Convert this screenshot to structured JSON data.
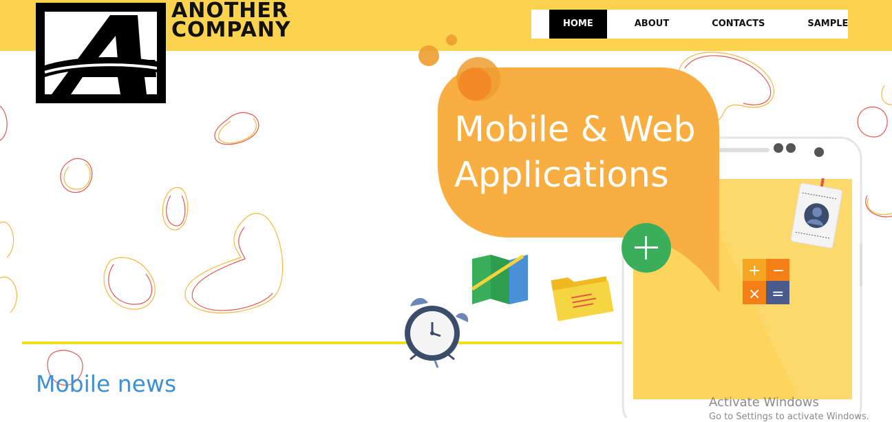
{
  "header": {
    "company_name_line1": "ANOTHER",
    "company_name_line2": "COMPANY",
    "logo_letter": "A"
  },
  "nav": {
    "items": [
      {
        "label": "HOME",
        "active": true
      },
      {
        "label": "ABOUT",
        "active": false
      },
      {
        "label": "CONTACTS",
        "active": false
      },
      {
        "label": "SAMPLE",
        "active": false
      }
    ]
  },
  "hero": {
    "title_line1": "Mobile & Web",
    "title_line2": "Applications"
  },
  "main": {
    "section_title": "Mobile news"
  },
  "overlay": {
    "watermark_title": "Activate Windows",
    "watermark_subtitle": "Go to Settings to activate Windows."
  },
  "colors": {
    "header_bg": "#fcd34f",
    "bubble": "#f9ae42",
    "accent_line": "#f0e21a",
    "news_title": "#3e8fd6",
    "phone_screen": "#fdd55d"
  },
  "icons": [
    "logo-a-icon",
    "map-icon",
    "folder-icon",
    "alarm-clock-icon",
    "plus-icon",
    "calculator-icon",
    "id-badge-icon",
    "phone-icon"
  ]
}
